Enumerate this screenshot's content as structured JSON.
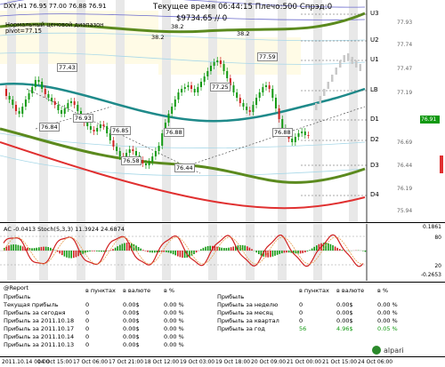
{
  "header": {
    "symbol_info": "DXY,H1  76.95 77.00 76.88 76.91",
    "server_time": "Текущее время 06:44:15 Плечо:500 Спрэд:0",
    "balance": "$9734.65  // 0",
    "pivot_line1": "Нормальный ценовой диапазон",
    "pivot_line2": "pivot=77.15"
  },
  "pivot_levels": {
    "U3": "U3",
    "U2": "U2",
    "U1": "U1",
    "LB": "LB",
    "D1": "D1",
    "D2": "D2",
    "D3": "D3",
    "D4": "D4"
  },
  "right_axis": {
    "ticks": [
      "77.93",
      "77.74",
      "77.47",
      "77.19",
      "76.91",
      "76.69",
      "76.44",
      "76.19",
      "75.94"
    ],
    "current_price": "76.91"
  },
  "price_labels": [
    "77.43",
    "77.59",
    "77.25",
    "76.93",
    "76.84",
    "76.85",
    "76.88",
    "76.58",
    "76.44",
    "76.88",
    "38.2",
    "38.2",
    "38.2"
  ],
  "stoch": {
    "header": "AC -0.0413  Stoch(5,3,3) 11.3924 24.6874",
    "ticks": [
      "0.1861",
      "80",
      "20",
      "-0.2653"
    ]
  },
  "report": {
    "title": "@Report",
    "col_headers": {
      "points": "в пунктах",
      "currency": "в валюте",
      "percent": "в %"
    },
    "left_rows": [
      {
        "label": "Прибыль",
        "points": "",
        "currency": "",
        "percent": ""
      },
      {
        "label": "Текущая прибыль",
        "points": "0",
        "currency": "0.00$",
        "percent": "0.00 %"
      },
      {
        "label": "Прибыль за сегодня",
        "points": "0",
        "currency": "0.00$",
        "percent": "0.00 %"
      },
      {
        "label": "Прибыль за 2011.10.18",
        "points": "0",
        "currency": "0.00$",
        "percent": "0.00 %"
      },
      {
        "label": "Прибыль за 2011.10.17",
        "points": "0",
        "currency": "0.00$",
        "percent": "0.00 %"
      },
      {
        "label": "Прибыль за 2011.10.14",
        "points": "0",
        "currency": "0.00$",
        "percent": "0.00 %"
      },
      {
        "label": "Прибыль за 2011.10.13",
        "points": "0",
        "currency": "0.00$",
        "percent": "0.00 %"
      }
    ],
    "right_rows": [
      {
        "label": "Прибыль",
        "points": "",
        "currency": "",
        "percent": ""
      },
      {
        "label": "Прибыль за неделю",
        "points": "0",
        "currency": "0.00$",
        "percent": "0.00 %"
      },
      {
        "label": "Прибыль за месяц",
        "points": "0",
        "currency": "0.00$",
        "percent": "0.00 %"
      },
      {
        "label": "Прибыль за квартал",
        "points": "0",
        "currency": "0.00$",
        "percent": "0.00 %"
      },
      {
        "label": "Прибыль за год",
        "points": "56",
        "currency": "4.96$",
        "percent": "0.05 %"
      }
    ]
  },
  "date_axis": [
    "2011.10.14 00:00",
    "14 Oct 15:00",
    "17 Oct 06:00",
    "17 Oct 21:00",
    "18 Oct 12:00",
    "19 Oct 03:00",
    "19 Oct 18:00",
    "20 Oct 09:00",
    "21 Oct 00:00",
    "21 Oct 15:00",
    "24 Oct 06:00"
  ],
  "logo": {
    "text": "alpari"
  },
  "colors": {
    "green_band": "#5b8a1e",
    "teal_ma": "#1f8a8a",
    "red_ma": "#e03030",
    "candle": "#119911",
    "stoch": "#d02020",
    "accent_bg": "#fffbe6"
  }
}
